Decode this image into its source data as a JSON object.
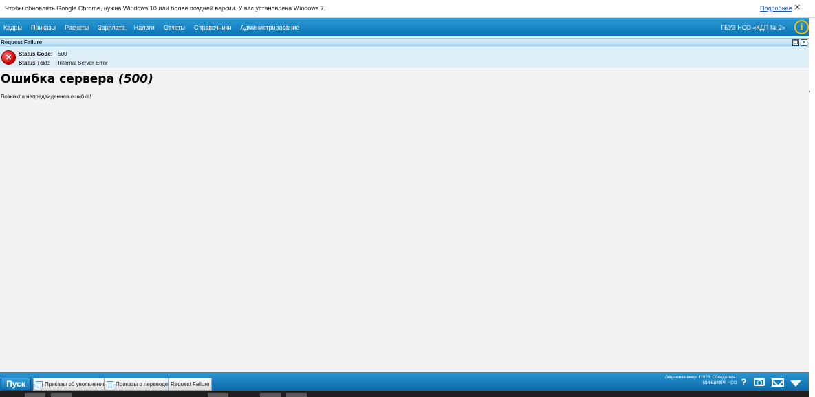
{
  "infobar": {
    "message": "Чтобы обновлять Google Chrome, нужна Windows 10 или более поздней версии. У вас установлена Windows 7.",
    "link": "Подробнее",
    "close_icon": "×"
  },
  "menu": {
    "items": [
      "Кадры",
      "Приказы",
      "Расчеты",
      "Зарплата",
      "Налоги",
      "Отчеты",
      "Справочники",
      "Администрирование"
    ],
    "organization": "ГБУЗ НСО «КДП № 2»",
    "info_icon": "i"
  },
  "panel": {
    "title": "Request Failure",
    "restore_icon": "❐",
    "close_icon": "×"
  },
  "status": {
    "code_label": "Status Code:",
    "code_value": "500",
    "text_label": "Status Text:",
    "text_value": "Internal Server Error",
    "error_icon": "×"
  },
  "error": {
    "title": "Ошибка сервера",
    "code": "(500)",
    "message": "Возникла непредвиденная ошибка!"
  },
  "taskbar": {
    "start": "Пуск",
    "tasks": [
      "Приказы об увольнении",
      "Приказы о переводе",
      "Request Failure"
    ],
    "license_line1": "Лицензия номер: 11626; Обладатель:",
    "license_line2": "МИНЦИФРА НСО",
    "help_icon": "?"
  },
  "colors": {
    "menu_bar": "#0b72b5",
    "panel_header": "#b6dbf0",
    "status_box": "#dfeff9",
    "error_red": "#c40000",
    "info_yellow": "#f1c40f"
  }
}
